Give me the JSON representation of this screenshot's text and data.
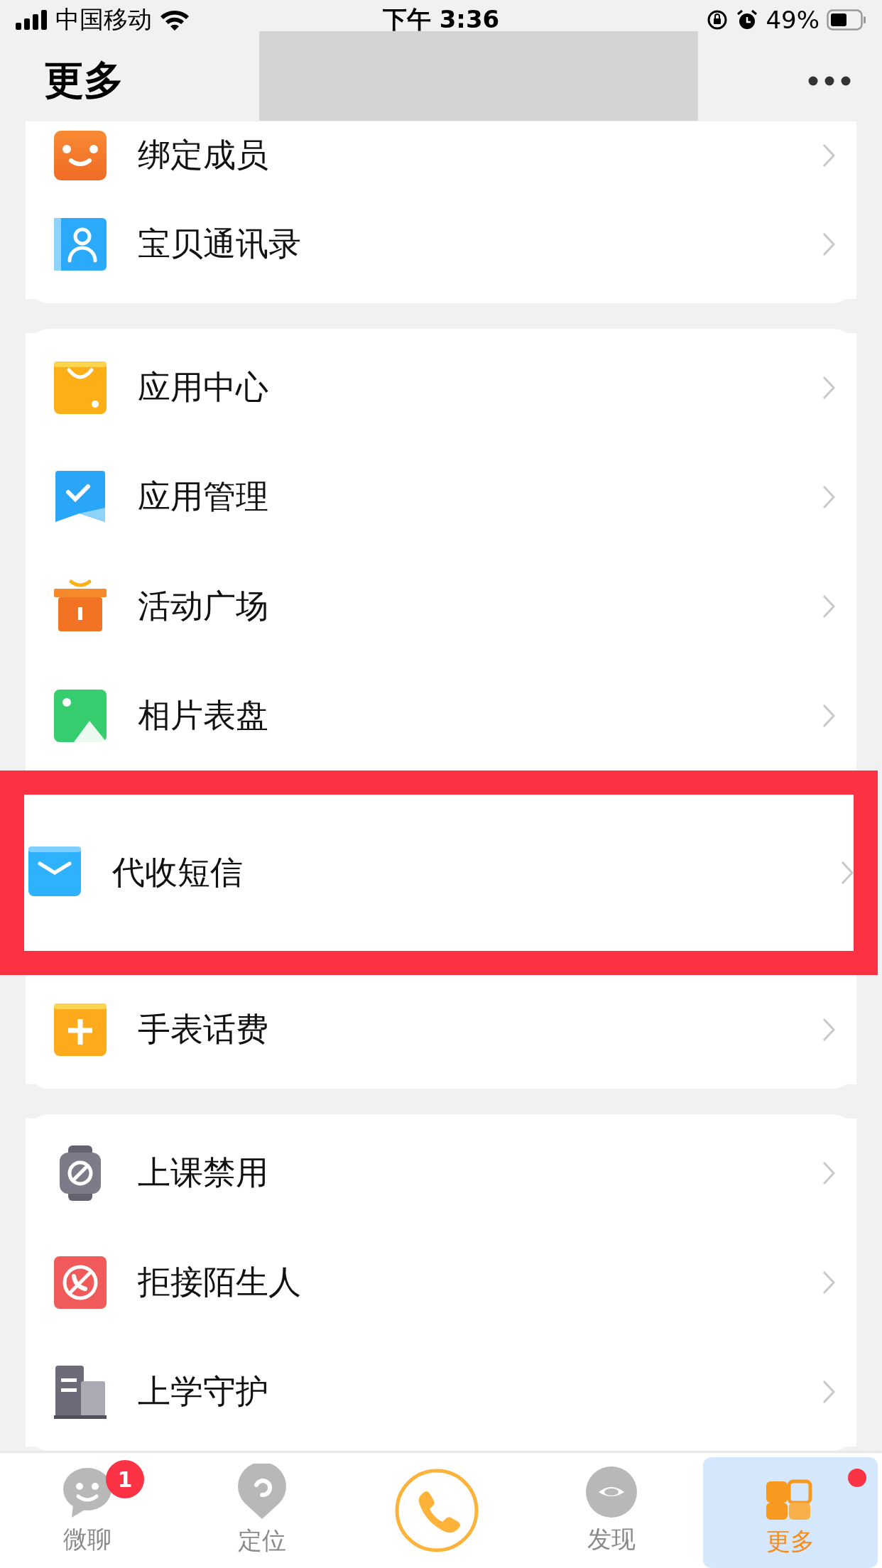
{
  "status_bar": {
    "carrier": "中国移动",
    "time": "下午 3:36",
    "battery": "49%"
  },
  "header": {
    "title": "更多"
  },
  "sections": [
    {
      "items": [
        {
          "label": "绑定成员",
          "highlighted": false
        },
        {
          "label": "宝贝通讯录",
          "highlighted": false
        }
      ]
    },
    {
      "items": [
        {
          "label": "应用中心",
          "highlighted": false
        },
        {
          "label": "应用管理",
          "highlighted": false
        },
        {
          "label": "活动广场",
          "highlighted": false
        },
        {
          "label": "相片表盘",
          "highlighted": false
        },
        {
          "label": "代收短信",
          "highlighted": true
        },
        {
          "label": "手表话费",
          "highlighted": false
        }
      ]
    },
    {
      "items": [
        {
          "label": "上课禁用",
          "highlighted": false
        },
        {
          "label": "拒接陌生人",
          "highlighted": false
        },
        {
          "label": "上学守护",
          "highlighted": false
        }
      ]
    }
  ],
  "tab_bar": [
    {
      "kind": "tab",
      "label": "微聊",
      "selected": false,
      "badge": "1",
      "dot": false
    },
    {
      "kind": "tab",
      "label": "定位",
      "selected": false,
      "dot": false
    },
    {
      "kind": "call"
    },
    {
      "kind": "tab",
      "label": "发现",
      "selected": false,
      "dot": false
    },
    {
      "kind": "tab",
      "label": "更多",
      "selected": true,
      "dot": true
    }
  ]
}
